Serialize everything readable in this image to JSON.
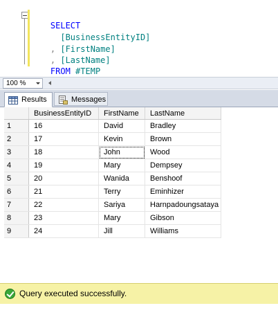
{
  "editor": {
    "lines": [
      {
        "kw": "SELECT",
        "punct": "",
        "id": ""
      },
      {
        "kw": "",
        "punct": "  ",
        "id": "[BusinessEntityID]"
      },
      {
        "kw": "",
        "punct": ", ",
        "id": "[FirstName]"
      },
      {
        "kw": "",
        "punct": ", ",
        "id": "[LastName]"
      },
      {
        "kw": "FROM",
        "punct": " ",
        "id": "#TEMP"
      }
    ]
  },
  "zoom": {
    "value": "100 %"
  },
  "tabs": [
    {
      "label": "Results",
      "icon": "grid-icon"
    },
    {
      "label": "Messages",
      "icon": "messages-icon"
    }
  ],
  "grid": {
    "columns": [
      "BusinessEntityID",
      "FirstName",
      "LastName"
    ],
    "rows": [
      {
        "num": "1",
        "cells": [
          "16",
          "David",
          "Bradley"
        ]
      },
      {
        "num": "2",
        "cells": [
          "17",
          "Kevin",
          "Brown"
        ]
      },
      {
        "num": "3",
        "cells": [
          "18",
          "John",
          "Wood"
        ]
      },
      {
        "num": "4",
        "cells": [
          "19",
          "Mary",
          "Dempsey"
        ]
      },
      {
        "num": "5",
        "cells": [
          "20",
          "Wanida",
          "Benshoof"
        ]
      },
      {
        "num": "6",
        "cells": [
          "21",
          "Terry",
          "Eminhizer"
        ]
      },
      {
        "num": "7",
        "cells": [
          "22",
          "Sariya",
          "Harnpadoungsataya"
        ]
      },
      {
        "num": "8",
        "cells": [
          "23",
          "Mary",
          "Gibson"
        ]
      },
      {
        "num": "9",
        "cells": [
          "24",
          "Jill",
          "Williams"
        ]
      }
    ],
    "selected_cell": {
      "row": 2,
      "col": 1
    }
  },
  "status": {
    "text": "Query executed successfully.",
    "icon": "success-check-icon"
  },
  "colors": {
    "keyword": "#0000ff",
    "identifier": "#008080",
    "status_background": "#f6f2a6"
  }
}
